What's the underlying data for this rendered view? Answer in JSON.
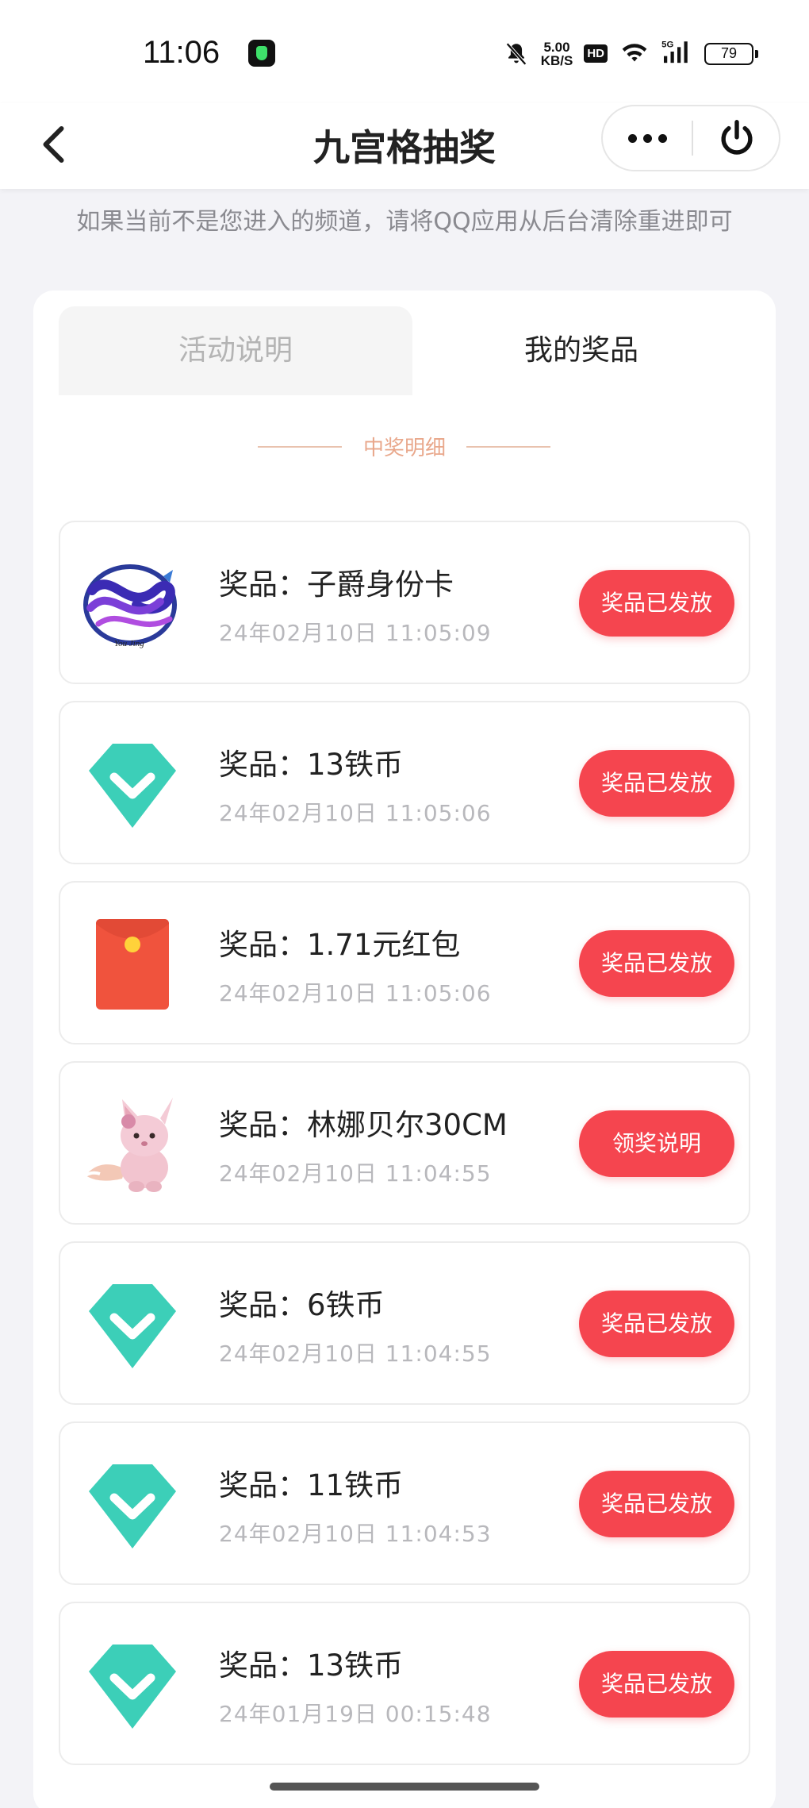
{
  "status": {
    "time": "11:06",
    "speed_top": "5.00",
    "speed_bottom": "KB/S",
    "hd": "HD",
    "network": "5G",
    "battery": "79"
  },
  "nav": {
    "title": "九宫格抽奖"
  },
  "hint": "如果当前不是您进入的频道，请将QQ应用从后台清除重进即可",
  "tabs": {
    "left": "活动说明",
    "right": "我的奖品"
  },
  "section_title": "中奖明细",
  "prizes": [
    {
      "name": "奖品：子爵身份卡",
      "time": "24年02月10日  11:05:09",
      "button": "奖品已发放",
      "icon": "youjing-logo-icon"
    },
    {
      "name": "奖品：13铁币",
      "time": "24年02月10日  11:05:06",
      "button": "奖品已发放",
      "icon": "diamond-coin-icon"
    },
    {
      "name": "奖品：1.71元红包",
      "time": "24年02月10日  11:05:06",
      "button": "奖品已发放",
      "icon": "red-envelope-icon"
    },
    {
      "name": "奖品：林娜贝尔30CM",
      "time": "24年02月10日  11:04:55",
      "button": "领奖说明",
      "icon": "plush-fox-icon"
    },
    {
      "name": "奖品：6铁币",
      "time": "24年02月10日  11:04:55",
      "button": "奖品已发放",
      "icon": "diamond-coin-icon"
    },
    {
      "name": "奖品：11铁币",
      "time": "24年02月10日  11:04:53",
      "button": "奖品已发放",
      "icon": "diamond-coin-icon"
    },
    {
      "name": "奖品：13铁币",
      "time": "24年01月19日  00:15:48",
      "button": "奖品已发放",
      "icon": "diamond-coin-icon"
    }
  ],
  "colors": {
    "accent_button": "#f5454f",
    "coin_teal": "#3ccfb8",
    "section_title": "#e9a88c"
  }
}
